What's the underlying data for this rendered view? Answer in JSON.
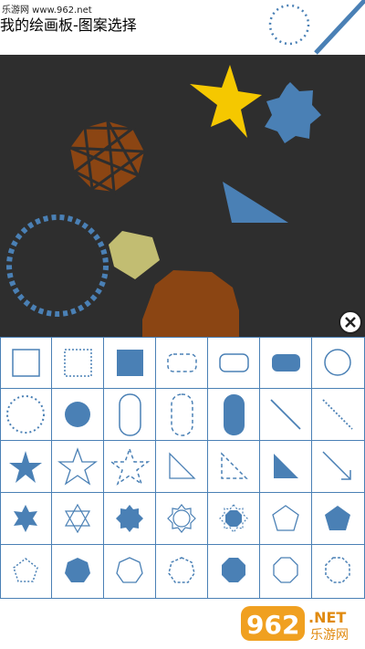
{
  "app": {
    "title": "我的绘画板-图案选择",
    "watermark_site": "乐游网 www.962.net"
  },
  "logo": {
    "main": "962",
    "suffix": ".NET",
    "subtitle": "乐游网"
  },
  "colors": {
    "canvas_bg": "#2e2e2e",
    "accent_blue": "#4a80b5",
    "star_yellow": "#f5c800",
    "brown": "#8b4513",
    "khaki": "#c2bd72",
    "grid_line": "#4a80b5"
  },
  "canvas": {
    "items": [
      {
        "shape": "star-5",
        "color": "yellow"
      },
      {
        "shape": "star-7",
        "color": "blue"
      },
      {
        "shape": "heptagon-with-star",
        "color": "brown"
      },
      {
        "shape": "right-triangle",
        "color": "blue"
      },
      {
        "shape": "dotted-circle",
        "color": "blue"
      },
      {
        "shape": "pentagon",
        "color": "khaki"
      },
      {
        "shape": "octagon",
        "color": "brown"
      }
    ]
  },
  "palette": {
    "columns": 7,
    "rows": 5,
    "icons": [
      [
        "square-outline-icon",
        "square-dotted-icon",
        "square-filled-icon",
        "rounded-rect-dashed-icon",
        "rounded-rect-outline-icon",
        "rounded-rect-filled-icon",
        "circle-outline-icon"
      ],
      [
        "circle-dotted-icon",
        "circle-filled-icon",
        "capsule-outline-icon",
        "capsule-dashed-icon",
        "capsule-filled-icon",
        "line-solid-icon",
        "line-dotted-icon"
      ],
      [
        "star-filled-icon",
        "star-outline-icon",
        "star-dashed-icon",
        "triangle-outline-icon",
        "triangle-dashed-icon",
        "triangle-filled-icon",
        "arrow-icon"
      ],
      [
        "star6-filled-icon",
        "star6-outline-icon",
        "star8-filled-icon",
        "star8-outline-icon",
        "octagon-star-icon",
        "pentagon-outline-icon",
        "pentagon-filled-icon"
      ],
      [
        "pentagon-dotted-icon",
        "heptagon-filled-icon",
        "heptagon-outline-icon",
        "heptagon-dashed-icon",
        "octagon-filled-icon",
        "octagon-outline-icon",
        "octagon-dashed-icon"
      ]
    ]
  }
}
